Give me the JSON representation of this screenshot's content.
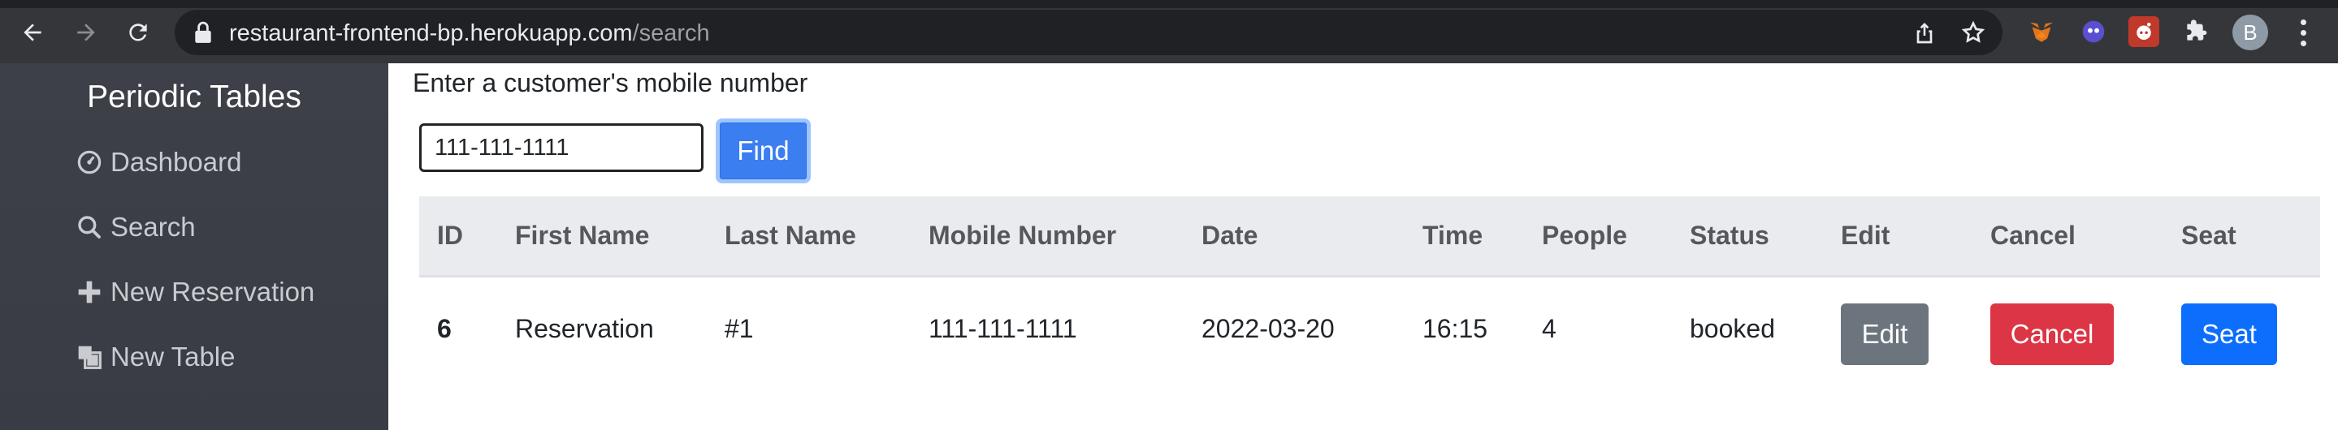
{
  "browser": {
    "url_host": "restaurant-frontend-bp.herokuapp.com",
    "url_path": "/search",
    "profile_initial": "B"
  },
  "sidebar": {
    "brand": "Periodic Tables",
    "items": [
      {
        "label": "Dashboard",
        "icon": "dashboard-icon"
      },
      {
        "label": "Search",
        "icon": "search-icon"
      },
      {
        "label": "New Reservation",
        "icon": "plus-icon"
      },
      {
        "label": "New Table",
        "icon": "layers-icon"
      }
    ]
  },
  "search": {
    "prompt": "Enter a customer's mobile number",
    "value": "111-111-1111",
    "button_label": "Find"
  },
  "table": {
    "headers": [
      "ID",
      "First Name",
      "Last Name",
      "Mobile Number",
      "Date",
      "Time",
      "People",
      "Status",
      "Edit",
      "Cancel",
      "Seat"
    ],
    "rows": [
      {
        "id": "6",
        "first_name": "Reservation",
        "last_name": "#1",
        "mobile": "111-111-1111",
        "date": "2022-03-20",
        "time": "16:15",
        "people": "4",
        "status": "booked",
        "edit_label": "Edit",
        "cancel_label": "Cancel",
        "seat_label": "Seat"
      }
    ]
  },
  "colors": {
    "sidebar_bg": "#3e4049",
    "primary": "#0d6efd",
    "danger": "#dc3545",
    "secondary": "#6c757d"
  }
}
